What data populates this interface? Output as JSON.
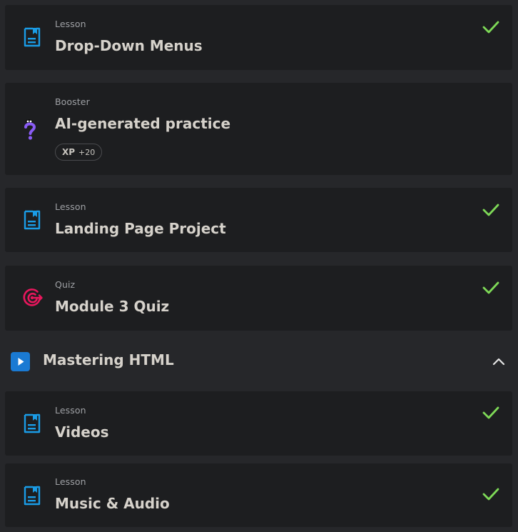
{
  "items": [
    {
      "type": "Lesson",
      "title": "Drop-Down Menus",
      "icon": "lesson-doc-icon",
      "completed": true
    },
    {
      "type": "Booster",
      "title": "AI-generated practice",
      "icon": "booster-question-icon",
      "completed": false,
      "xp_label": "XP",
      "xp_value": "+20"
    },
    {
      "type": "Lesson",
      "title": "Landing Page Project",
      "icon": "lesson-doc-icon",
      "completed": true
    },
    {
      "type": "Quiz",
      "title": "Module 3 Quiz",
      "icon": "quiz-target-icon",
      "completed": true
    }
  ],
  "section": {
    "title": "Mastering HTML",
    "icon": "play-icon",
    "expanded": true,
    "items": [
      {
        "type": "Lesson",
        "title": "Videos",
        "icon": "lesson-doc-icon",
        "completed": true
      },
      {
        "type": "Lesson",
        "title": "Music & Audio",
        "icon": "lesson-doc-icon",
        "completed": true
      }
    ]
  },
  "colors": {
    "background": "#26272a",
    "card": "#1d1e20",
    "check": "#7ed957",
    "lesson_icon": "#1a9ce6",
    "quiz_icon": "#e8175d",
    "booster_icon": "#8a5cf6",
    "section_icon": "#1a7ad3"
  }
}
